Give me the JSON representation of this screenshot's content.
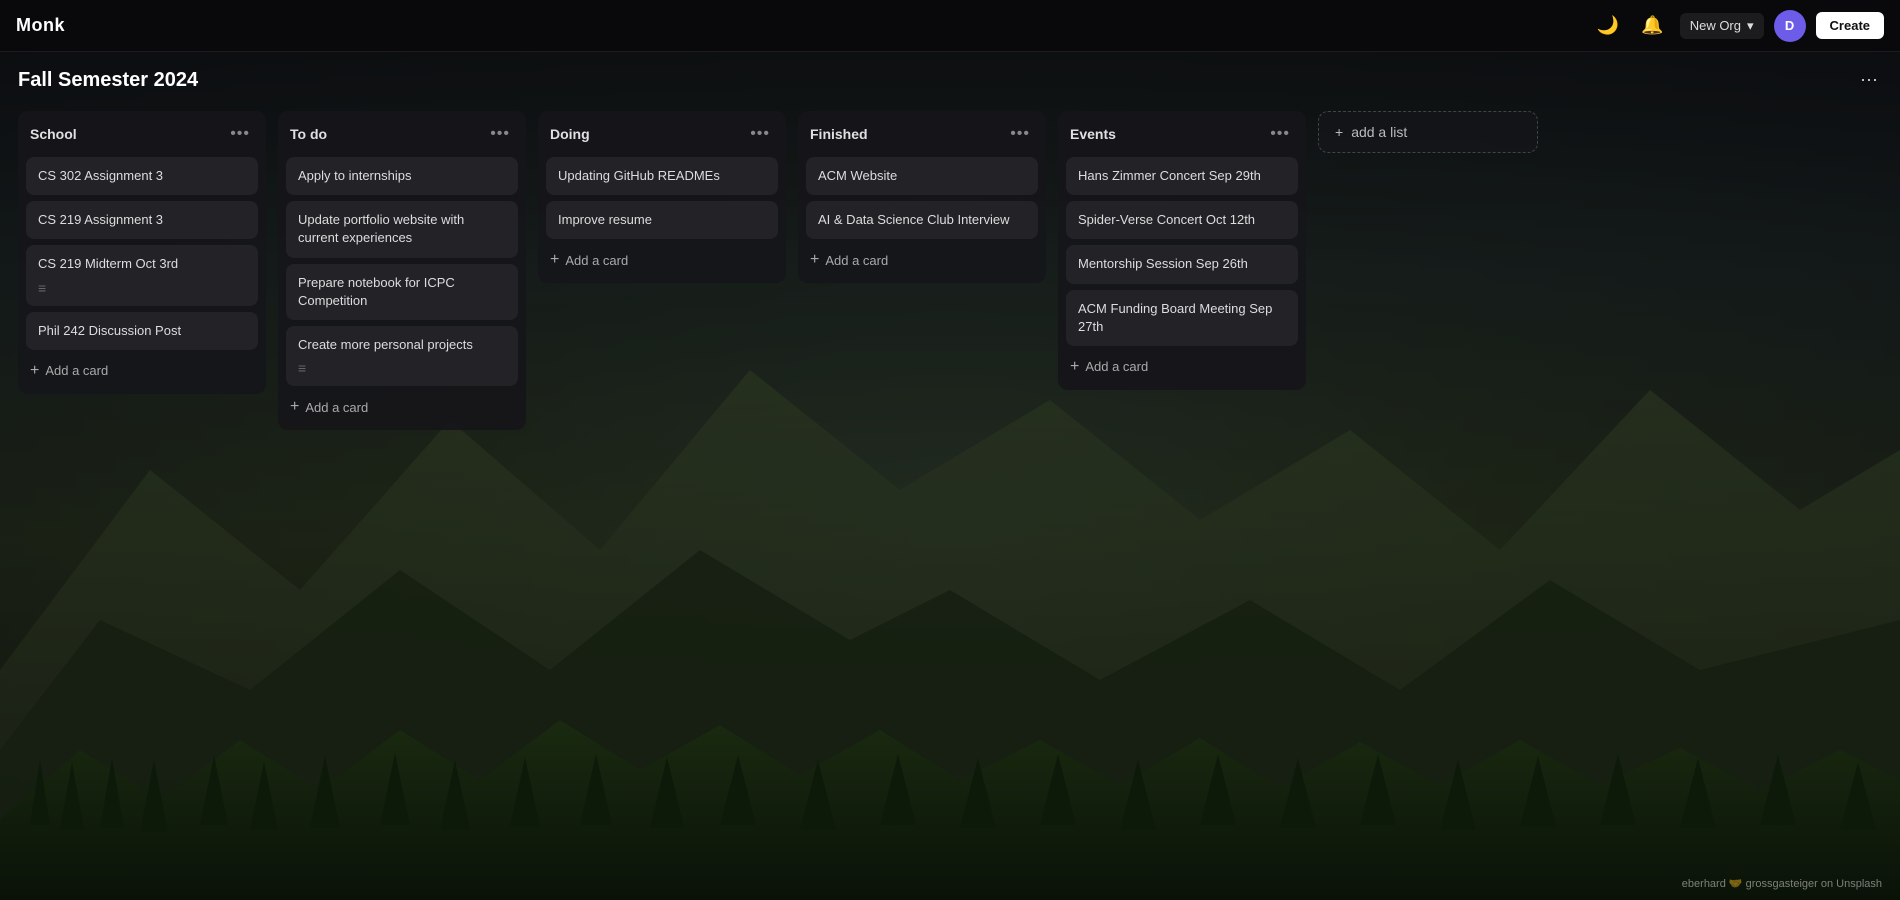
{
  "app": {
    "logo": "Monk",
    "org": "New Org",
    "create_label": "Create",
    "avatar_initials": "D"
  },
  "board": {
    "title": "Fall Semester 2024",
    "footer_credit": "eberhard 🤝 grossgasteiger on Unsplash"
  },
  "lists": [
    {
      "id": "school",
      "title": "School",
      "cards": [
        {
          "text": "CS 302 Assignment 3",
          "has_icon": false
        },
        {
          "text": "CS 219 Assignment 3",
          "has_icon": false
        },
        {
          "text": "CS 219 Midterm Oct 3rd",
          "has_icon": true
        },
        {
          "text": "Phil 242 Discussion Post",
          "has_icon": false
        }
      ],
      "add_label": "Add a card"
    },
    {
      "id": "todo",
      "title": "To do",
      "cards": [
        {
          "text": "Apply to internships",
          "has_icon": false
        },
        {
          "text": "Update portfolio website with current experiences",
          "has_icon": false
        },
        {
          "text": "Prepare notebook for ICPC Competition",
          "has_icon": false
        },
        {
          "text": "Create more personal projects",
          "has_icon": true
        }
      ],
      "add_label": "Add a card"
    },
    {
      "id": "doing",
      "title": "Doing",
      "cards": [
        {
          "text": "Updating GitHub READMEs",
          "has_icon": false
        },
        {
          "text": "Improve resume",
          "has_icon": false
        }
      ],
      "add_label": "Add a card"
    },
    {
      "id": "finished",
      "title": "Finished",
      "cards": [
        {
          "text": "ACM Website",
          "has_icon": false
        },
        {
          "text": "AI & Data Science Club Interview",
          "has_icon": false
        }
      ],
      "add_label": "Add a card"
    },
    {
      "id": "events",
      "title": "Events",
      "cards": [
        {
          "text": "Hans Zimmer Concert Sep 29th",
          "has_icon": false
        },
        {
          "text": "Spider-Verse Concert Oct 12th",
          "has_icon": false
        },
        {
          "text": "Mentorship Session Sep 26th",
          "has_icon": false
        },
        {
          "text": "ACM Funding Board Meeting Sep 27th",
          "has_icon": false
        }
      ],
      "add_label": "Add a card"
    }
  ],
  "add_list_label": "add a list"
}
